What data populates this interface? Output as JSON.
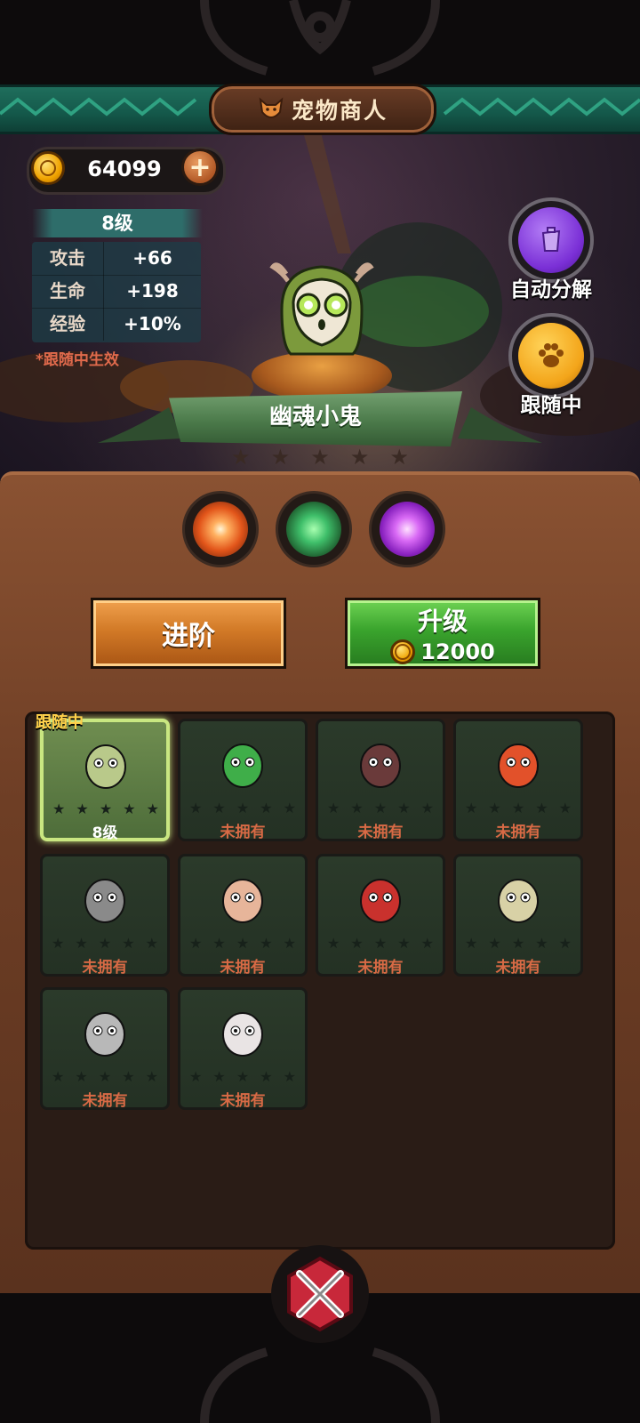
{
  "header": {
    "title": "宠物商人",
    "title_icon": "fox-icon"
  },
  "currency": {
    "coins": "64099",
    "coin_icon": "gold-coin-icon",
    "add_icon": "plus-icon"
  },
  "pet_stats": {
    "level": "8级",
    "rows": [
      {
        "key": "攻击",
        "value": "+66"
      },
      {
        "key": "生命",
        "value": "+198"
      },
      {
        "key": "经验",
        "value": "+10%"
      }
    ],
    "note": "*跟随中生效"
  },
  "side_buttons": {
    "auto_decompose": {
      "label": "自动分解",
      "icon": "trash-bin-icon",
      "color": "#8a3ee0"
    },
    "following": {
      "label": "跟随中",
      "icon": "paw-icon",
      "color": "#f3a51a"
    }
  },
  "selected_pet": {
    "name": "幽魂小鬼",
    "stars": 5,
    "stars_filled": 0
  },
  "skills": [
    {
      "icon": "sparkle-burst-icon",
      "color": "#ff8a3c"
    },
    {
      "icon": "green-claw-icon",
      "color": "#3fbf6a"
    },
    {
      "icon": "purple-chat-icon",
      "color": "#c04ee8"
    }
  ],
  "actions": {
    "advance_label": "进阶",
    "upgrade_label": "升级",
    "upgrade_cost": "12000"
  },
  "pet_grid": {
    "follow_tag": "跟随中",
    "items": [
      {
        "name": "ghost-imp",
        "label": "8级",
        "selected": true,
        "color": "#b9c98a"
      },
      {
        "name": "green-duck",
        "label": "未拥有",
        "selected": false,
        "color": "#3fae49"
      },
      {
        "name": "chest-mimic",
        "label": "未拥有",
        "selected": false,
        "color": "#6a3a3a"
      },
      {
        "name": "fire-dragon",
        "label": "未拥有",
        "selected": false,
        "color": "#e2512a"
      },
      {
        "name": "knight-helmet",
        "label": "未拥有",
        "selected": false,
        "color": "#8a8a8a"
      },
      {
        "name": "rooster",
        "label": "未拥有",
        "selected": false,
        "color": "#e7b59a"
      },
      {
        "name": "daruma",
        "label": "未拥有",
        "selected": false,
        "color": "#c9312d"
      },
      {
        "name": "chick",
        "label": "未拥有",
        "selected": false,
        "color": "#d8d1a6"
      },
      {
        "name": "gauntlet",
        "label": "未拥有",
        "selected": false,
        "color": "#b8b8b8"
      },
      {
        "name": "clown-bird",
        "label": "未拥有",
        "selected": false,
        "color": "#e9e4e4"
      }
    ]
  },
  "close": {
    "icon": "close-icon"
  }
}
